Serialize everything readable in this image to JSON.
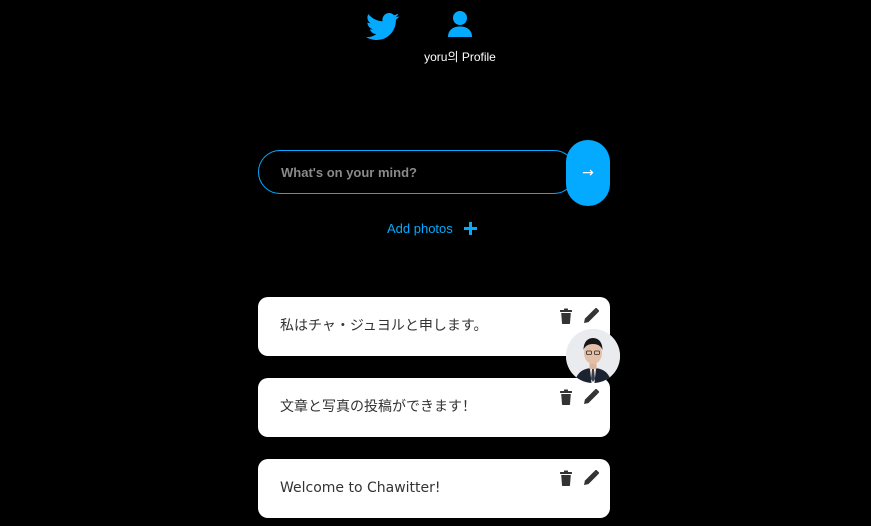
{
  "nav": {
    "home_icon": "twitter-bird-icon",
    "profile_icon": "user-icon",
    "profile_label": "yoru의 Profile"
  },
  "composer": {
    "placeholder": "What's on your mind?",
    "submit_label": "→",
    "add_photos_label": "Add photos",
    "add_photos_icon": "plus-icon"
  },
  "tweets": [
    {
      "text": "私はチャ・ジュヨルと申します。",
      "has_photo": true
    },
    {
      "text": "文章と写真の投稿ができます！",
      "has_photo": false
    },
    {
      "text": "Welcome to Chawitter!",
      "has_photo": false
    }
  ],
  "tweet_actions": {
    "delete_icon": "trash-icon",
    "edit_icon": "pencil-icon"
  },
  "colors": {
    "accent": "#04aaff",
    "background": "#000000",
    "card": "#ffffff",
    "card_text": "#333333"
  }
}
